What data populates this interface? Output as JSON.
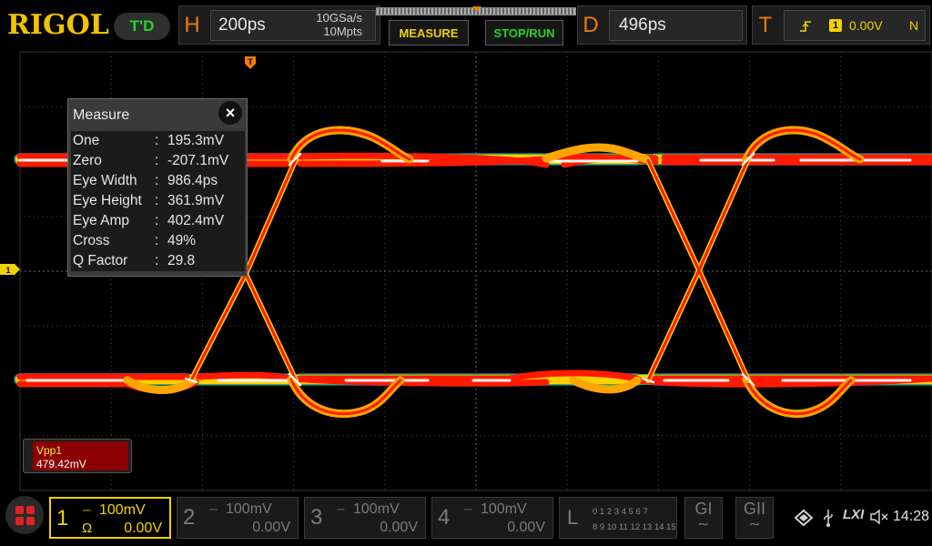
{
  "brand": {
    "logo": "RIGOL",
    "trigger_mode": "T'D"
  },
  "horizontal": {
    "letter": "H",
    "timebase": "200ps",
    "sample_rate": "10GSa/s",
    "memory_depth": "10Mpts"
  },
  "buttons": {
    "measure": "MEASURE",
    "stop_run": "STOP/RUN"
  },
  "delay": {
    "letter": "D",
    "value": "496ps"
  },
  "trigger": {
    "letter": "T",
    "source": "1",
    "level": "0.00V",
    "coupling": "N",
    "marker": "T"
  },
  "channel_marker": "1",
  "measure_panel": {
    "title": "Measure",
    "close": "×",
    "rows": [
      {
        "label": "One",
        "value": "195.3mV"
      },
      {
        "label": "Zero",
        "value": "-207.1mV"
      },
      {
        "label": "Eye Width",
        "value": "986.4ps"
      },
      {
        "label": "Eye Height",
        "value": "361.9mV"
      },
      {
        "label": "Eye Amp",
        "value": "402.4mV"
      },
      {
        "label": "Cross",
        "value": "49%"
      },
      {
        "label": "Q Factor",
        "value": "29.8"
      }
    ],
    "separator": ":"
  },
  "vpp": {
    "label": "Vpp1",
    "value": "479.42mV"
  },
  "channels": [
    {
      "num": "1",
      "scale": "100mV",
      "impedance": "Ω",
      "offset": "0.00V"
    },
    {
      "num": "2",
      "scale": "100mV",
      "offset": "0.00V"
    },
    {
      "num": "3",
      "scale": "100mV",
      "offset": "0.00V"
    },
    {
      "num": "4",
      "scale": "100mV",
      "offset": "0.00V"
    }
  ],
  "la": {
    "letter": "L",
    "row1": "0 1 2 3  4 5 6 7",
    "row2": "8 9 10 11 12 13 14 15"
  },
  "gen": {
    "g1": "GI",
    "g2": "GII",
    "wave": "∼"
  },
  "status": {
    "lxi": "LXI",
    "clock": "14:28"
  },
  "colors": {
    "accent": "#f2d200",
    "orange": "#f07d00",
    "green": "#27d42a",
    "trace_red": "#ff1a00",
    "trace_yellow": "#ffd000"
  }
}
